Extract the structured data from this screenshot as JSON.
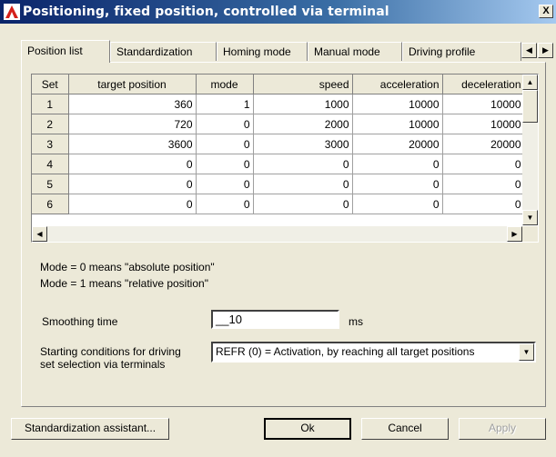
{
  "window": {
    "title": "Positioning, fixed position, controlled via terminal",
    "close_label": "X"
  },
  "tabs": [
    {
      "label": "Position list"
    },
    {
      "label": "Standardization"
    },
    {
      "label": "Homing mode"
    },
    {
      "label": "Manual mode"
    },
    {
      "label": "Driving profile"
    }
  ],
  "grid": {
    "columns": [
      "Set",
      "target position",
      "mode",
      "speed",
      "acceleration",
      "deceleration"
    ],
    "rows": [
      [
        "1",
        "360",
        "1",
        "1000",
        "10000",
        "10000"
      ],
      [
        "2",
        "720",
        "0",
        "2000",
        "10000",
        "10000"
      ],
      [
        "3",
        "3600",
        "0",
        "3000",
        "20000",
        "20000"
      ],
      [
        "4",
        "0",
        "0",
        "0",
        "0",
        "0"
      ],
      [
        "5",
        "0",
        "0",
        "0",
        "0",
        "0"
      ],
      [
        "6",
        "0",
        "0",
        "0",
        "0",
        "0"
      ]
    ]
  },
  "notes": {
    "line1": "Mode = 0 means \"absolute position\"",
    "line2": "Mode = 1 means \"relative position\""
  },
  "smoothing": {
    "label": "Smoothing time",
    "value": "__10",
    "unit": "ms"
  },
  "starting": {
    "label_line1": "Starting conditions for driving",
    "label_line2": "set selection via terminals",
    "value": "REFR (0) = Activation, by reaching all target positions"
  },
  "buttons": {
    "assistant": "Standardization assistant...",
    "ok": "Ok",
    "cancel": "Cancel",
    "apply": "Apply"
  }
}
